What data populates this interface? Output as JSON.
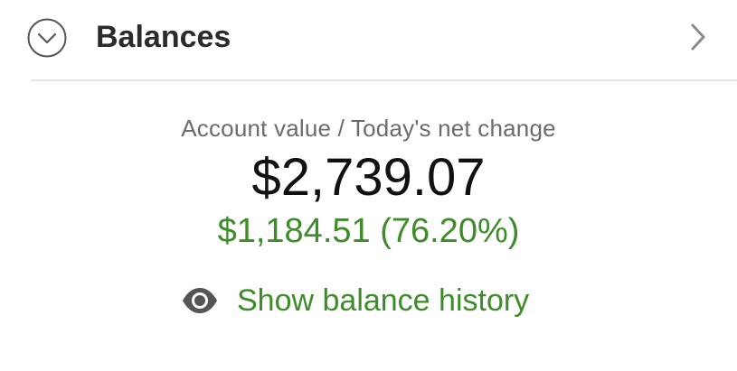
{
  "header": {
    "title": "Balances",
    "collapse_icon": "chevron-down-circle-icon",
    "navigate_icon": "chevron-right-icon"
  },
  "summary": {
    "label": "Account value / Today's net change",
    "account_value": "$2,739.07",
    "net_change": "$1,184.51 (76.20%)"
  },
  "history": {
    "label": "Show balance history",
    "icon": "eye-icon"
  },
  "colors": {
    "positive": "#3e8b2a",
    "title": "#2b2b2b",
    "muted": "#6b6b6b",
    "divider": "#e6e6e6"
  }
}
